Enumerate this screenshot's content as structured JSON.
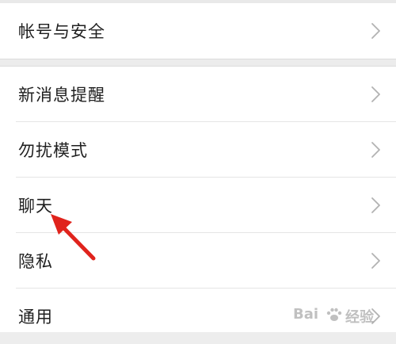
{
  "settings": {
    "group1": [
      {
        "label": "帐号与安全",
        "chevron": "chevron-right-icon"
      }
    ],
    "group2": [
      {
        "label": "新消息提醒",
        "chevron": "chevron-right-icon"
      },
      {
        "label": "勿扰模式",
        "chevron": "chevron-right-icon"
      },
      {
        "label": "聊天",
        "chevron": "chevron-right-icon"
      },
      {
        "label": "隐私",
        "chevron": "chevron-right-icon"
      },
      {
        "label": "通用",
        "chevron": "chevron-right-icon"
      }
    ]
  },
  "annotation": {
    "arrow_color": "#e0231c",
    "points_to": "聊天"
  },
  "watermark": {
    "brand_left": "Bai",
    "brand_right": "经验",
    "icon": "paw-icon"
  },
  "colors": {
    "background": "#ededed",
    "row_background": "#ffffff",
    "text": "#1f1f1f",
    "chevron": "#b2b2b2"
  }
}
